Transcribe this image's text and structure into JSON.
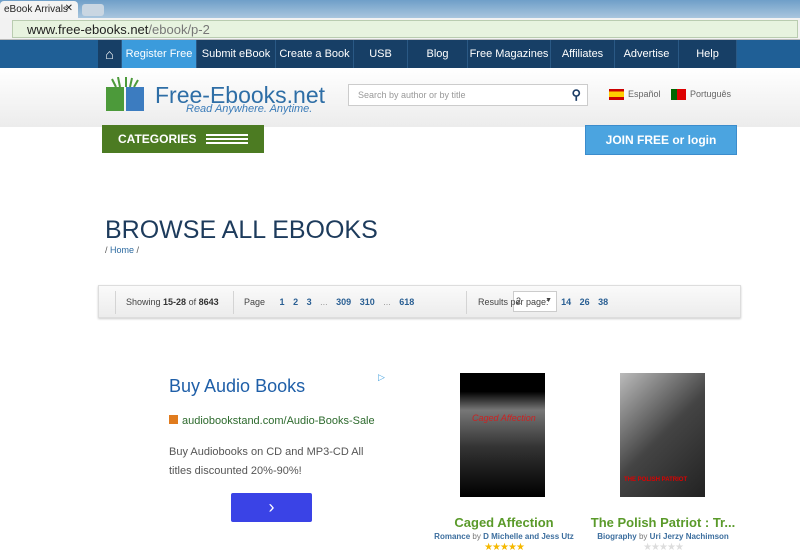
{
  "browser": {
    "tab_title": "eBook Arrivals",
    "url_host": "www.free-ebooks.net",
    "url_path": "/ebook/p-2"
  },
  "nav": {
    "items": [
      "Register Free",
      "Submit eBook",
      "Create a Book",
      "USB",
      "Blog",
      "Free Magazines",
      "Affiliates",
      "Advertise",
      "Help"
    ]
  },
  "header": {
    "logo": "Free-Ebooks.net",
    "tagline": "Read Anywhere. Anytime.",
    "search_placeholder": "Search by author or by title",
    "languages": [
      "Español",
      "Português"
    ]
  },
  "categories_label": "CATEGORIES",
  "join_label": "JOIN FREE or login",
  "page_title": "BROWSE ALL EBOOKS",
  "breadcrumb": {
    "home": "Home"
  },
  "pager": {
    "showing_prefix": "Showing",
    "range": "15-28",
    "of": "of",
    "total": "8643",
    "page_label": "Page",
    "pages": [
      "1",
      "2",
      "3",
      "...",
      "309",
      "310",
      "...",
      "618"
    ],
    "selected_page": "2",
    "results_label": "Results per page:",
    "results_options": [
      "14",
      "26",
      "38"
    ]
  },
  "ad": {
    "title": "Buy Audio Books",
    "url": "audiobookstand.com/Audio-Books-Sale",
    "body": "Buy Audiobooks on CD and MP3-CD All titles discounted 20%-90%!",
    "button": "›"
  },
  "books": [
    {
      "title": "Caged Affection",
      "genre": "Romance",
      "by": "by",
      "author": "D Michelle and Jess Utz",
      "rating": 5,
      "cover_text": "Caged Affection"
    },
    {
      "title": "The Polish Patriot : Tr...",
      "genre": "Biography",
      "by": "by",
      "author": "Uri Jerzy Nachimson",
      "rating": 0,
      "cover_text": "THE POLISH PATRIOT"
    }
  ]
}
